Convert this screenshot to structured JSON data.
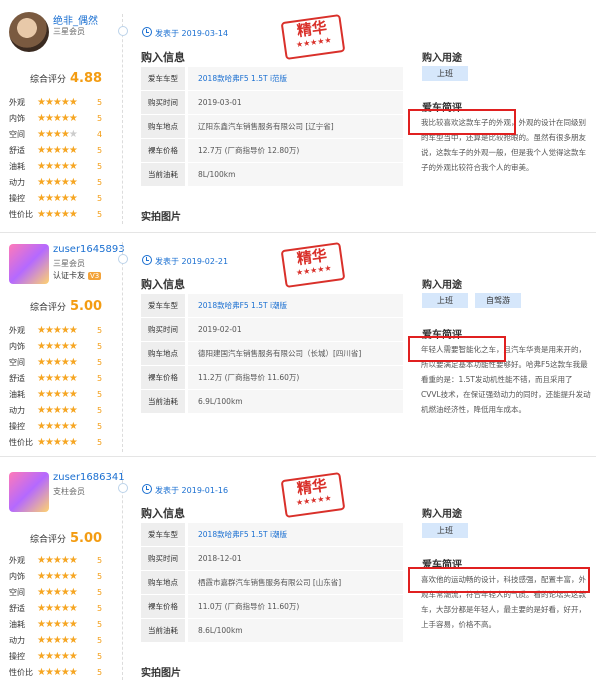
{
  "labels": {
    "score": "综合评分",
    "posted_prefix": "发表于",
    "purchase_info": "购入信息",
    "purchase_usage": "购入用途",
    "brief": "爱车简评",
    "photos": "实拍图片",
    "stamp": "精华",
    "stamp_stars": "★★★★★",
    "field_labels": [
      "爱车车型",
      "购买时间",
      "购车地点",
      "裸车价格",
      "当前油耗"
    ]
  },
  "reviews": [
    {
      "user": {
        "name": "绝非_偶然",
        "level": "三星会员",
        "cert": "",
        "badge": ""
      },
      "score": "4.88",
      "ratings": [
        {
          "label": "外观",
          "stars": 5,
          "value": "5"
        },
        {
          "label": "内饰",
          "stars": 5,
          "value": "5"
        },
        {
          "label": "空间",
          "stars": 4,
          "value": "4"
        },
        {
          "label": "舒适",
          "stars": 5,
          "value": "5"
        },
        {
          "label": "油耗",
          "stars": 5,
          "value": "5"
        },
        {
          "label": "动力",
          "stars": 5,
          "value": "5"
        },
        {
          "label": "操控",
          "stars": 5,
          "value": "5"
        },
        {
          "label": "性价比",
          "stars": 5,
          "value": "5"
        }
      ],
      "date": "2019-03-14",
      "info": {
        "model": "2018款哈弗F5 1.5T i范版",
        "buy_time": "2019-03-01",
        "location": "辽阳东鑫汽车销售服务有限公司 [辽宁省]",
        "price": "12.7万 (厂商指导价 12.80万)",
        "fuel": "8L/100km"
      },
      "usage": [
        "上班"
      ],
      "brief": "我比较喜欢这款车子的外观，外观的设计在同级别的车型当中，还算是比较抢眼的。虽然有很多朋友说，这款车子的外观一般，但是我个人觉得这款车子的外观比较符合我个人的审美。"
    },
    {
      "user": {
        "name": "zuser1645893",
        "level": "三星会员",
        "cert": "认证卡友",
        "badge": "V3"
      },
      "score": "5.00",
      "ratings": [
        {
          "label": "外观",
          "stars": 5,
          "value": "5"
        },
        {
          "label": "内饰",
          "stars": 5,
          "value": "5"
        },
        {
          "label": "空间",
          "stars": 5,
          "value": "5"
        },
        {
          "label": "舒适",
          "stars": 5,
          "value": "5"
        },
        {
          "label": "油耗",
          "stars": 5,
          "value": "5"
        },
        {
          "label": "动力",
          "stars": 5,
          "value": "5"
        },
        {
          "label": "操控",
          "stars": 5,
          "value": "5"
        },
        {
          "label": "性价比",
          "stars": 5,
          "value": "5"
        }
      ],
      "date": "2019-02-21",
      "info": {
        "model": "2018款哈弗F5 1.5T i潮版",
        "buy_time": "2019-02-01",
        "location": "德阳建国汽车销售服务有限公司（长城）[四川省]",
        "price": "11.2万 (厂商指导价 11.60万)",
        "fuel": "6.9L/100km"
      },
      "usage": [
        "上班",
        "自驾游"
      ],
      "brief": "年轻人需要智能化之车，且汽车华贵是用来开的，所以要满足基本功能性要够好。哈弗F5这款车我最看重的是：1.5T发动机性能不错，而且采用了CVVL技术，在保证强劲动力的同时，还能提升发动机燃油经济性，降低用车成本。"
    },
    {
      "user": {
        "name": "zuser1686341",
        "level": "支柱会员",
        "cert": "",
        "badge": ""
      },
      "score": "5.00",
      "ratings": [
        {
          "label": "外观",
          "stars": 5,
          "value": "5"
        },
        {
          "label": "内饰",
          "stars": 5,
          "value": "5"
        },
        {
          "label": "空间",
          "stars": 5,
          "value": "5"
        },
        {
          "label": "舒适",
          "stars": 5,
          "value": "5"
        },
        {
          "label": "油耗",
          "stars": 5,
          "value": "5"
        },
        {
          "label": "动力",
          "stars": 5,
          "value": "5"
        },
        {
          "label": "操控",
          "stars": 5,
          "value": "5"
        },
        {
          "label": "性价比",
          "stars": 5,
          "value": "5"
        }
      ],
      "date": "2019-01-16",
      "info": {
        "model": "2018款哈弗F5 1.5T i潮版",
        "buy_time": "2018-12-01",
        "location": "栖霞市嘉群汽车销售服务有限公司 [山东省]",
        "price": "11.0万 (厂商指导价 11.60万)",
        "fuel": "8.6L/100km"
      },
      "usage": [
        "上班"
      ],
      "brief": "喜欢他的运动畅的设计，科技感强，配置丰富，外观车常潮流，符合年轻人的气质。看的论坛买这款车，大部分都是年轻人，最主要的是好看，好开，上手容易，价格不高。"
    }
  ],
  "colors": {
    "accent": "#1a6fd1",
    "score": "#f39c12",
    "stamp": "#d9302a",
    "star": "#f6a623",
    "highlight": "#e02020"
  }
}
